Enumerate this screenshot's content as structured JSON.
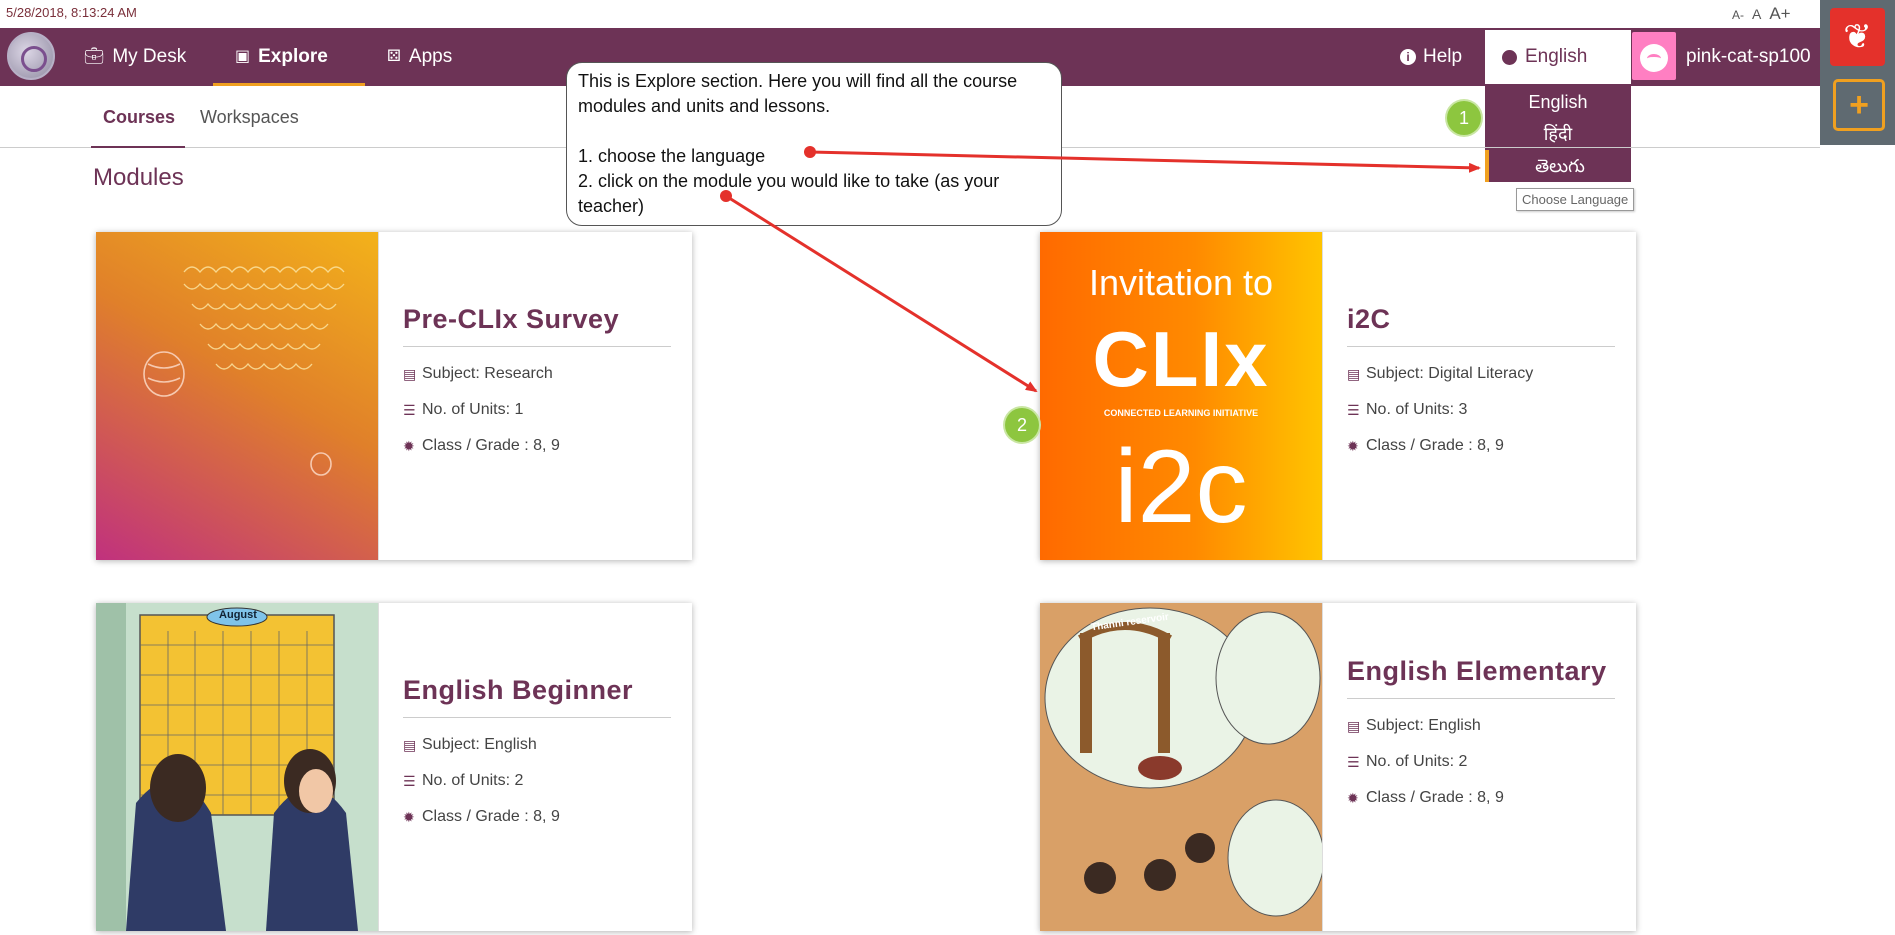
{
  "timestamp": "5/28/2018, 8:13:24 AM",
  "font_controls": {
    "decrease": "A-",
    "normal": "A",
    "increase": "A+"
  },
  "nav": {
    "my_desk": "My Desk",
    "explore": "Explore",
    "apps": "Apps",
    "help": "Help",
    "language": "English",
    "username": "pink-cat-sp100"
  },
  "language_dropdown": {
    "options": [
      "English",
      "हिंदी",
      "తెలుగు"
    ],
    "tooltip": "Choose Language"
  },
  "subtabs": {
    "courses": "Courses",
    "workspaces": "Workspaces"
  },
  "section_title": "Modules",
  "cards": [
    {
      "title": "Pre-CLIx Survey",
      "subject": "Subject: Research",
      "units": "No. of Units: 1",
      "grade": "Class / Grade : 8, 9"
    },
    {
      "title": "i2C",
      "subject": "Subject: Digital Literacy",
      "units": "No. of Units: 3",
      "grade": "Class / Grade : 8, 9",
      "image_text": {
        "line1": "Invitation to",
        "logo": "CLIx",
        "tagline": "CONNECTED LEARNING INITIATIVE",
        "big": "i2c"
      }
    },
    {
      "title": "English Beginner",
      "subject": "Subject: English",
      "units": "No. of Units: 2",
      "grade": "Class / Grade : 8, 9",
      "image_text": {
        "month": "August"
      }
    },
    {
      "title": "English Elementary",
      "subject": "Subject: English",
      "units": "No. of Units: 2",
      "grade": "Class / Grade : 8, 9",
      "image_text": {
        "sign": "Thanni reservoir"
      }
    }
  ],
  "annotation": {
    "text": "This is Explore section. Here you will find all the course modules and units and lessons.\n\n1. choose the language\n2. click on the module you would like to take (as your teacher)",
    "badge1": "1",
    "badge2": "2"
  },
  "colors": {
    "brand": "#6d3356",
    "accent": "#f0a020",
    "badge": "#8dc63f",
    "arrow": "#e4312b"
  }
}
